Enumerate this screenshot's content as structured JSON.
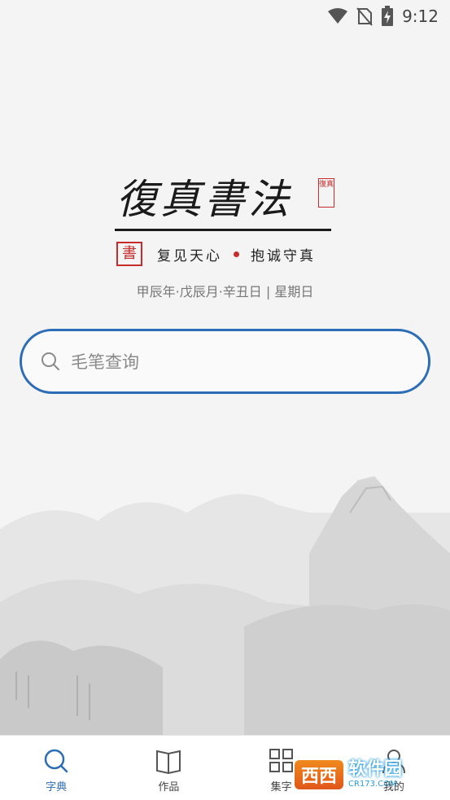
{
  "status": {
    "time": "9:12"
  },
  "logo": {
    "title": "復真書法",
    "small_seal": "復真",
    "big_seal": "書",
    "slogan_left": "复见天心",
    "slogan_right": "抱诚守真"
  },
  "date": {
    "lunar": "甲辰年·戊辰月·辛丑日 | 星期日"
  },
  "search": {
    "placeholder": "毛笔查询"
  },
  "tabs": [
    {
      "label": "字典",
      "icon": "search-icon",
      "active": true
    },
    {
      "label": "作品",
      "icon": "book-icon",
      "active": false
    },
    {
      "label": "集字",
      "icon": "grid-icon",
      "active": false
    },
    {
      "label": "我的",
      "icon": "user-icon",
      "active": false
    }
  ],
  "watermark": {
    "logo": "西西",
    "text": "软件园",
    "sub": "CR173.COM"
  },
  "colors": {
    "accent": "#2d6db5",
    "seal_red": "#c72b2b",
    "background": "#f4f4f4"
  }
}
